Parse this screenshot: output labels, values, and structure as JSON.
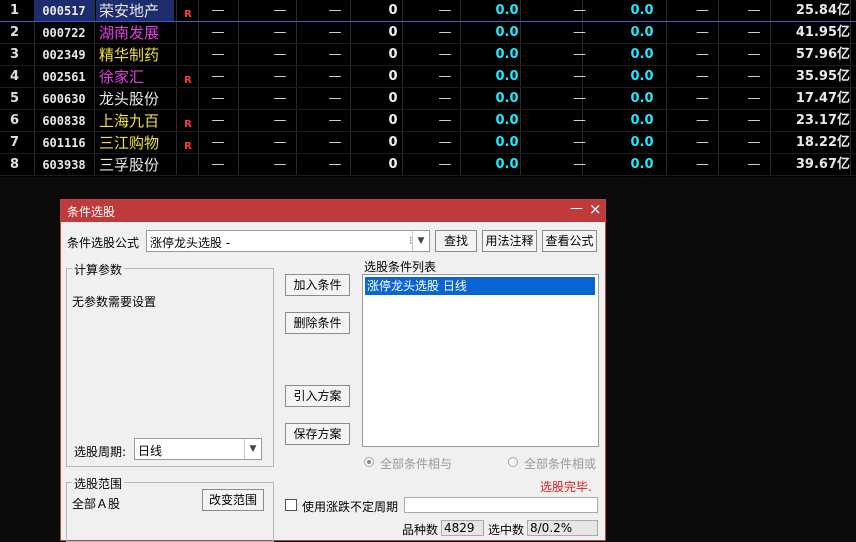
{
  "stocks": [
    {
      "idx": "1",
      "code": "000517",
      "name": "荣安地产",
      "name_color": "#e8e8e8",
      "r": "R",
      "c1": "—",
      "c2": "—",
      "c3": "—",
      "c4": "0",
      "c5": "—",
      "c6": "0.0",
      "c7": "—",
      "c8": "0.0",
      "c9": "—",
      "c10": "—",
      "mcap": "25.84亿"
    },
    {
      "idx": "2",
      "code": "000722",
      "name": "湖南发展",
      "name_color": "#e040e0",
      "r": "",
      "c1": "—",
      "c2": "—",
      "c3": "—",
      "c4": "0",
      "c5": "—",
      "c6": "0.0",
      "c7": "—",
      "c8": "0.0",
      "c9": "—",
      "c10": "—",
      "mcap": "41.95亿"
    },
    {
      "idx": "3",
      "code": "002349",
      "name": "精华制药",
      "name_color": "#f0e040",
      "r": "",
      "c1": "—",
      "c2": "—",
      "c3": "—",
      "c4": "0",
      "c5": "—",
      "c6": "0.0",
      "c7": "—",
      "c8": "0.0",
      "c9": "—",
      "c10": "—",
      "mcap": "57.96亿"
    },
    {
      "idx": "4",
      "code": "002561",
      "name": "徐家汇",
      "name_color": "#e040e0",
      "r": "R",
      "c1": "—",
      "c2": "—",
      "c3": "—",
      "c4": "0",
      "c5": "—",
      "c6": "0.0",
      "c7": "—",
      "c8": "0.0",
      "c9": "—",
      "c10": "—",
      "mcap": "35.95亿"
    },
    {
      "idx": "5",
      "code": "600630",
      "name": "龙头股份",
      "name_color": "#e8e8e8",
      "r": "",
      "c1": "—",
      "c2": "—",
      "c3": "—",
      "c4": "0",
      "c5": "—",
      "c6": "0.0",
      "c7": "—",
      "c8": "0.0",
      "c9": "—",
      "c10": "—",
      "mcap": "17.47亿"
    },
    {
      "idx": "6",
      "code": "600838",
      "name": "上海九百",
      "name_color": "#f0e040",
      "r": "R",
      "c1": "—",
      "c2": "—",
      "c3": "—",
      "c4": "0",
      "c5": "—",
      "c6": "0.0",
      "c7": "—",
      "c8": "0.0",
      "c9": "—",
      "c10": "—",
      "mcap": "23.17亿"
    },
    {
      "idx": "7",
      "code": "601116",
      "name": "三江购物",
      "name_color": "#f0e040",
      "r": "R",
      "c1": "—",
      "c2": "—",
      "c3": "—",
      "c4": "0",
      "c5": "—",
      "c6": "0.0",
      "c7": "—",
      "c8": "0.0",
      "c9": "—",
      "c10": "—",
      "mcap": "18.22亿"
    },
    {
      "idx": "8",
      "code": "603938",
      "name": "三孚股份",
      "name_color": "#e8e8e8",
      "r": "",
      "c1": "—",
      "c2": "—",
      "c3": "—",
      "c4": "0",
      "c5": "—",
      "c6": "0.0",
      "c7": "—",
      "c8": "0.0",
      "c9": "—",
      "c10": "—",
      "mcap": "39.67亿"
    }
  ],
  "dialog": {
    "title": "条件选股",
    "min_icon": "minimize-icon",
    "close_icon": "close-icon",
    "formula_label": "条件选股公式",
    "formula_value": "涨停龙头选股 -",
    "find_btn": "查找",
    "usage_btn": "用法注释",
    "view_btn": "查看公式",
    "params_group": "计算参数",
    "params_text": "无参数需要设置",
    "period_label": "选股周期:",
    "period_value": "日线",
    "add_btn": "加入条件",
    "del_btn": "删除条件",
    "import_btn": "引入方案",
    "save_btn": "保存方案",
    "cond_list_label": "选股条件列表",
    "cond_items": [
      "涨停龙头选股  日线"
    ],
    "radio_and": "全部条件相与",
    "radio_or": "全部条件相或",
    "status": "选股完毕.",
    "status_color": "#d02020",
    "range_group": "选股范围",
    "range_text": "全部Ａ股",
    "change_range_btn": "改变范围",
    "use_period_label": "使用涨跌不定周期",
    "count_label": "品种数",
    "count_value": "4829",
    "selected_label": "选中数",
    "selected_value": "8/0.2%"
  }
}
